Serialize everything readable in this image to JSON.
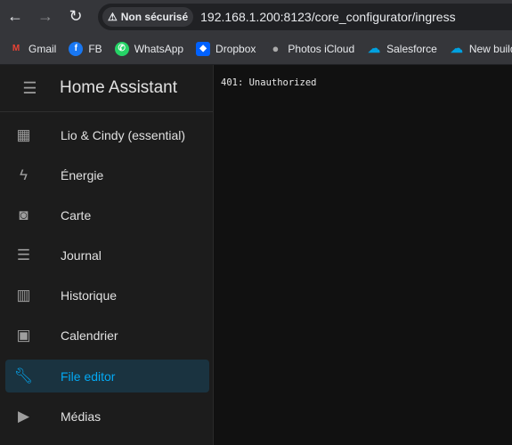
{
  "browser": {
    "security_label": "Non sécurisé",
    "url": "192.168.1.200:8123/core_configurator/ingress",
    "bookmarks": [
      {
        "label": "Gmail",
        "icon": "gmail-icon"
      },
      {
        "label": "FB",
        "icon": "facebook-icon"
      },
      {
        "label": "WhatsApp",
        "icon": "whatsapp-icon"
      },
      {
        "label": "Dropbox",
        "icon": "dropbox-icon"
      },
      {
        "label": "Photos iCloud",
        "icon": "apple-icon"
      },
      {
        "label": "Salesforce",
        "icon": "salesforce-icon"
      },
      {
        "label": "New building",
        "icon": "salesforce-icon"
      }
    ]
  },
  "sidebar": {
    "title": "Home Assistant",
    "items": [
      {
        "label": "Lio & Cindy (essential)",
        "icon": "dashboard-icon"
      },
      {
        "label": "Énergie",
        "icon": "lightning-icon"
      },
      {
        "label": "Carte",
        "icon": "map-account-icon"
      },
      {
        "label": "Journal",
        "icon": "list-icon"
      },
      {
        "label": "Historique",
        "icon": "chart-icon"
      },
      {
        "label": "Calendrier",
        "icon": "calendar-icon"
      },
      {
        "label": "File editor",
        "icon": "wrench-icon",
        "selected": true
      },
      {
        "label": "Médias",
        "icon": "play-box-icon"
      }
    ]
  },
  "main": {
    "message": "401: Unauthorized"
  },
  "colors": {
    "accent": "#03a9f4",
    "sidebar_bg": "#1c1c1c",
    "main_bg": "#111111"
  }
}
